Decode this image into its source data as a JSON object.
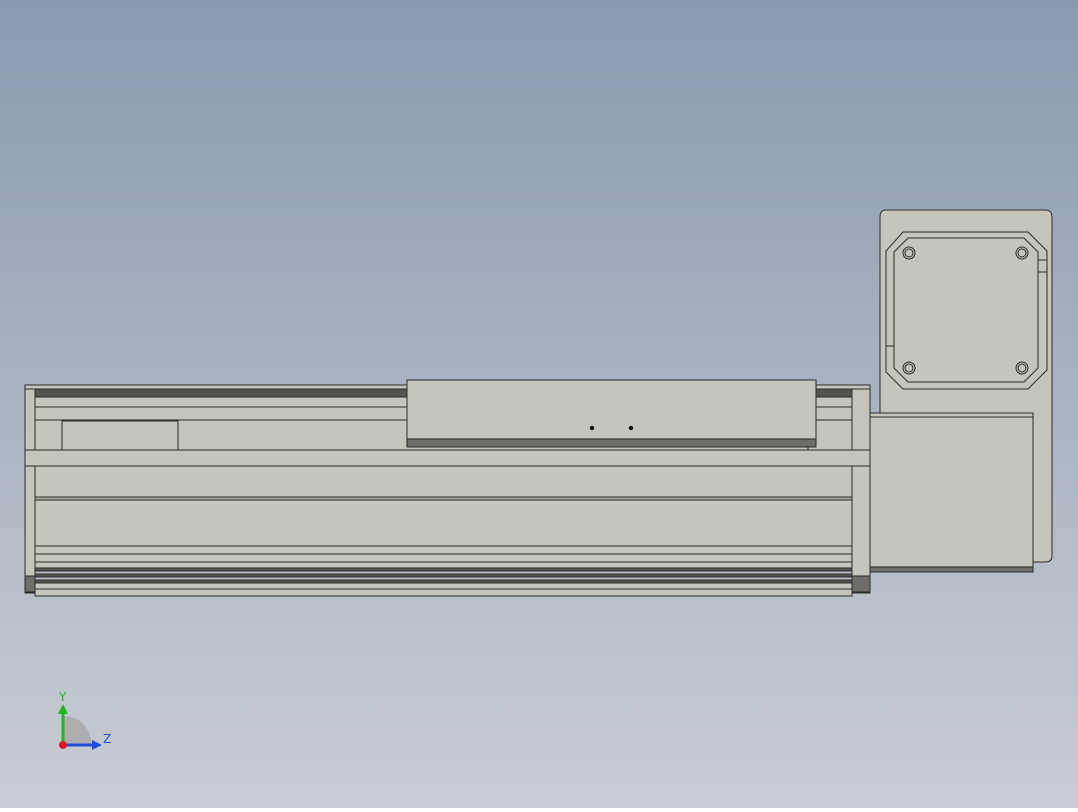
{
  "viewport": {
    "background_top": "#8a9aaf",
    "background_bottom": "#c9cdd4"
  },
  "colors": {
    "part_fill": "#c6c5bb",
    "part_shade": "#a9a89f",
    "dark_strip": "#555550",
    "edge_line": "#2b2b2b",
    "end_cap": "#6e6d67"
  },
  "triad": {
    "y_label": "Y",
    "z_label": "Z",
    "y_color": "#1db81d",
    "z_color": "#1f4fd8",
    "x_color": "#e01a1a"
  }
}
